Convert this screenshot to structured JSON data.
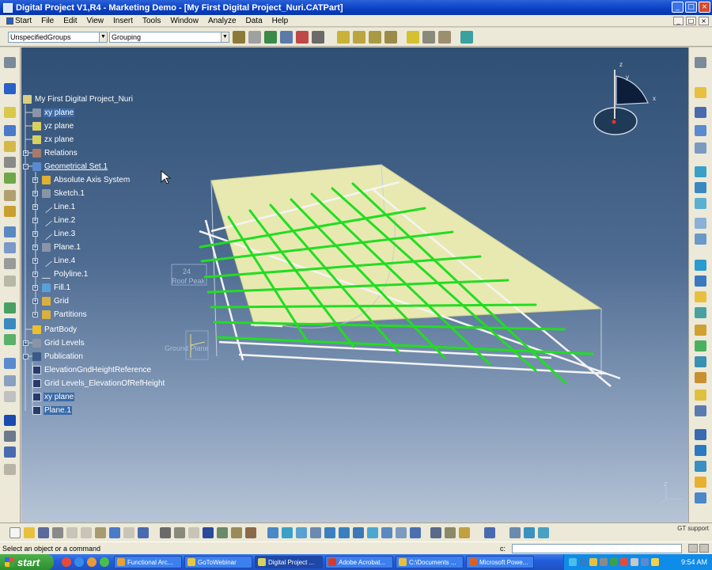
{
  "window": {
    "title": "Digital Project V1,R4  -  Marketing Demo - [My First Digital Project_Nuri.CATPart]",
    "buttons": [
      "_",
      "□",
      "×"
    ],
    "inner_buttons": [
      "_",
      "□",
      "×"
    ]
  },
  "menu": [
    "Start",
    "File",
    "Edit",
    "View",
    "Insert",
    "Tools",
    "Window",
    "Analyze",
    "Data",
    "Help"
  ],
  "toolbar": {
    "group_combo": "UnspecifiedGroups",
    "grouping_combo": "Grouping"
  },
  "tree": {
    "root": "My First Digital Project_Nuri",
    "items": [
      "xy plane",
      "yz plane",
      "zx plane",
      "Relations",
      "Geometrical Set.1",
      "Absolute Axis System",
      "Sketch.1",
      "Line.1",
      "Line.2",
      "Line.3",
      "Plane.1",
      "Line.4",
      "Polyline.1",
      "Fill.1",
      "Grid",
      "Partitions",
      "PartBody",
      "Grid Levels",
      "Publication",
      "ElevationGndHeightReference",
      "Grid Levels_ElevationOfRefHeight",
      "xy plane",
      "Plane.1"
    ]
  },
  "viewport": {
    "roof_tag_number": "24",
    "roof_tag_text": "Roof Peak",
    "ground_plane_label": "Ground Plane",
    "compass_labels": [
      "z",
      "y",
      "x"
    ],
    "mini_axis_label": "z",
    "colors": {
      "grid_lines": "#22dd22",
      "plane_fill": "#e8e9b0",
      "background_top": "#2f4f74",
      "background_bottom": "#b7c4d6"
    }
  },
  "status": {
    "message": "Select an object or a command",
    "command_prompt": "c:"
  },
  "support_label": "GT support",
  "taskbar": {
    "start": "start",
    "tasks": [
      "Functional Arc...",
      "GoToWebinar",
      "Digital Project ...",
      "Adobe Acrobat...",
      "C:\\Documents ...",
      "Microsoft Powe..."
    ],
    "clock": "9:54 AM"
  }
}
